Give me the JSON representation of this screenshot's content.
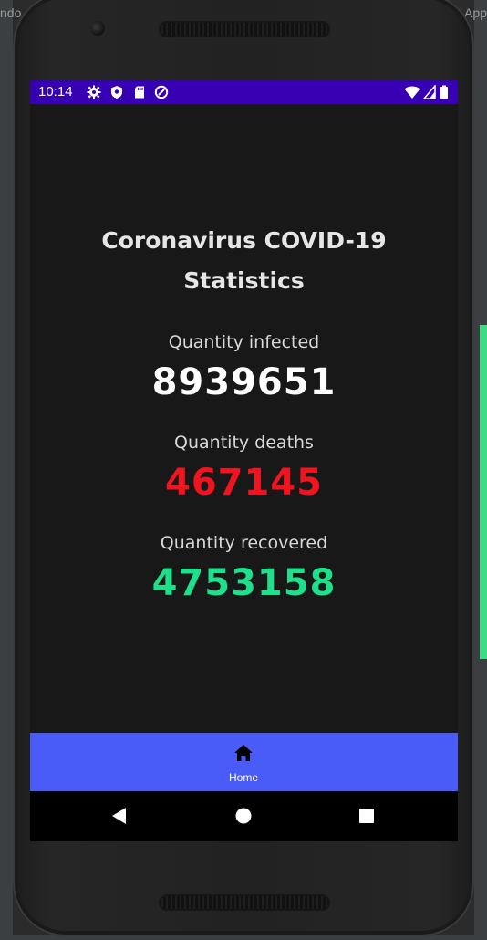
{
  "ide": {
    "left_text": "ndo",
    "right_text": "App"
  },
  "status_bar": {
    "time": "10:14",
    "background": "#3700b3"
  },
  "main": {
    "title_line1": "Coronavirus COVID-19",
    "title_line2": "Statistics",
    "stats": [
      {
        "label": "Quantity infected",
        "value": "8939651",
        "color": "#ffffff"
      },
      {
        "label": "Quantity deaths",
        "value": "467145",
        "color": "#f0141e"
      },
      {
        "label": "Quantity recovered",
        "value": "4753158",
        "color": "#1ee08a"
      }
    ]
  },
  "bottom_nav": {
    "items": [
      {
        "label": "Home",
        "icon": "home-icon"
      }
    ],
    "background": "#4a5cf7"
  },
  "system_nav": {
    "buttons": [
      "back-icon",
      "home-circle-icon",
      "recents-icon"
    ]
  }
}
